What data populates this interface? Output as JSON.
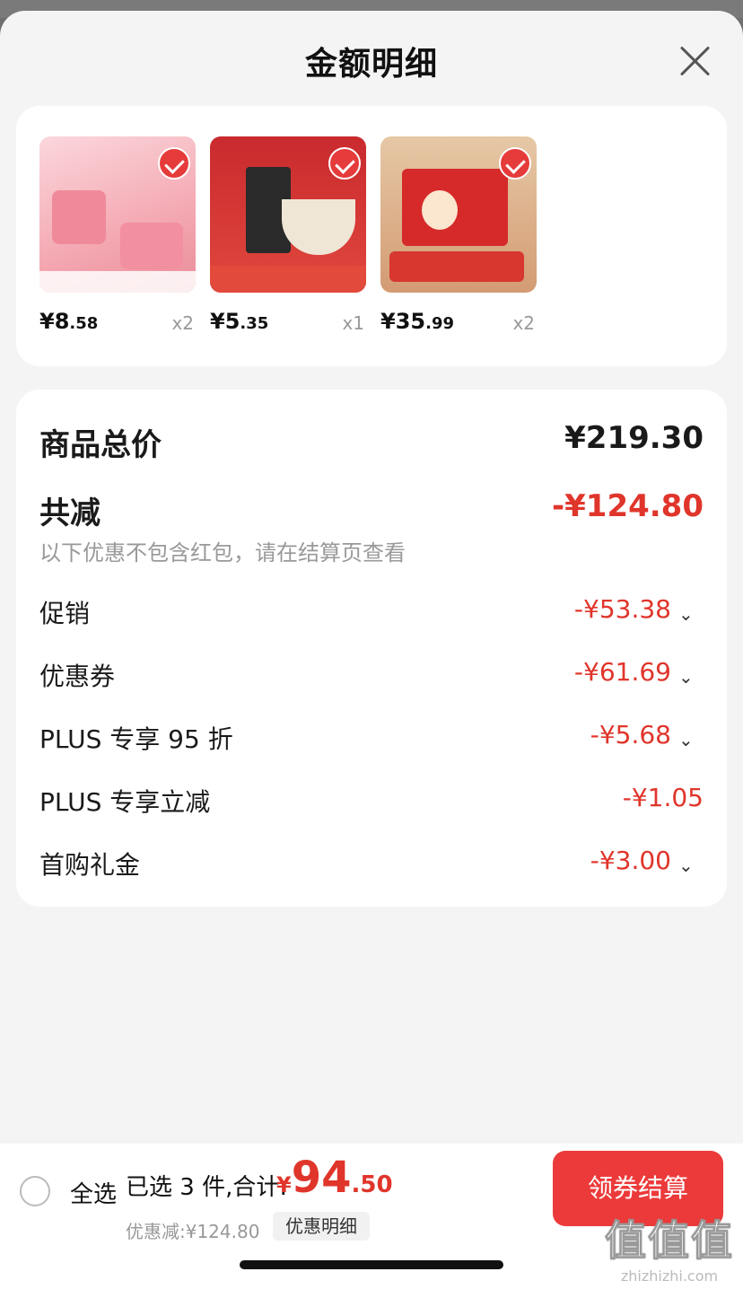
{
  "header": {
    "title": "金额明细"
  },
  "products": [
    {
      "price_int": "¥8",
      "price_dec": ".58",
      "qty": "x2",
      "thumb_color": "#f6b9c1"
    },
    {
      "price_int": "¥5",
      "price_dec": ".35",
      "qty": "x1",
      "thumb_color": "#c7282c"
    },
    {
      "price_int": "¥35",
      "price_dec": ".99",
      "qty": "x2",
      "thumb_color": "#d9b08c"
    }
  ],
  "summary": {
    "total_label": "商品总价",
    "total_value": "¥219.30",
    "reduce_label": "共减",
    "reduce_value": "-¥124.80",
    "note": "以下优惠不包含红包，请在结算页查看",
    "items": [
      {
        "label": "促销",
        "value": "-¥53.38"
      },
      {
        "label": "优惠券",
        "value": "-¥61.69"
      },
      {
        "label": "PLUS 专享 95 折",
        "value": "-¥5.68"
      },
      {
        "label": "PLUS 专享立减",
        "value": "-¥1.05"
      },
      {
        "label": "首购礼金",
        "value": "-¥3.00"
      }
    ]
  },
  "bottom": {
    "select_all": "全选",
    "selected": "已选 3 件,合计:",
    "yen": "¥",
    "total_int": "94",
    "total_dec": ".50",
    "discount": "优惠减:¥124.80",
    "detail_btn": "优惠明细",
    "checkout": "领券结算"
  },
  "watermark": {
    "big": "值值值",
    "small": "zhizhizhi.com"
  },
  "colors": {
    "accent": "#e0352b",
    "button": "#ec3a3a"
  }
}
